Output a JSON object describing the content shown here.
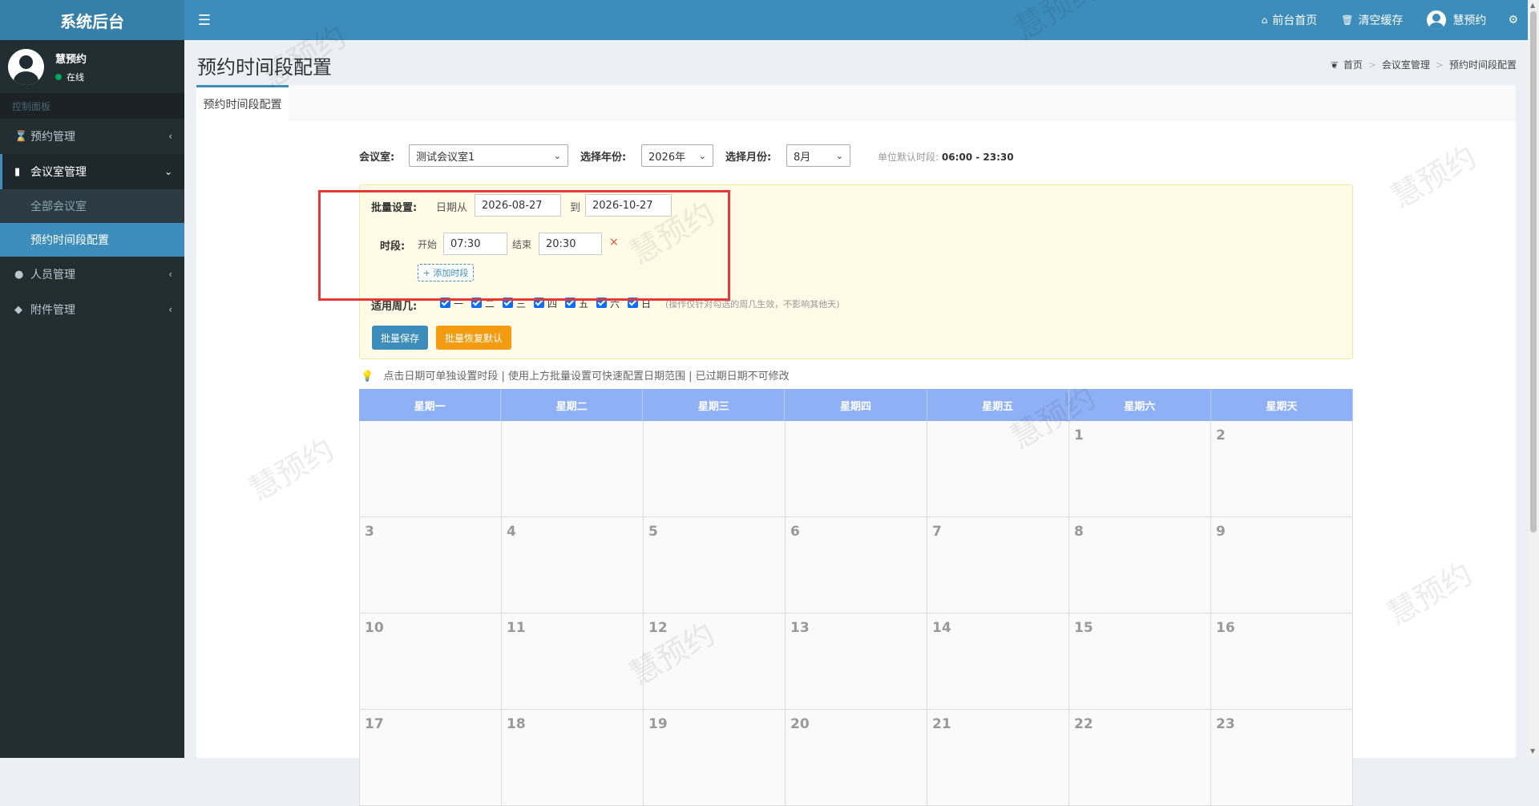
{
  "header": {
    "logo": "系统后台",
    "menu_toggle_icon": "menu-icon",
    "links": [
      {
        "icon": "home-icon",
        "label": "前台首页"
      },
      {
        "icon": "trash-icon",
        "label": "清空缓存"
      }
    ],
    "user_name": "慧预约",
    "settings_icon": "cogs-icon"
  },
  "sidebar": {
    "user_name": "慧预约",
    "user_status": "在线",
    "header": "控制面板",
    "items": [
      {
        "icon": "hourglass-icon",
        "label": "预约管理"
      },
      {
        "icon": "bookmark-icon",
        "label": "会议室管理"
      },
      {
        "icon": "user-icon",
        "label": "人员管理"
      },
      {
        "icon": "tags-icon",
        "label": "附件管理"
      }
    ],
    "subitems": [
      {
        "label": "全部会议室"
      },
      {
        "label": "预约时间段配置"
      }
    ]
  },
  "page": {
    "title": "预约时间段配置",
    "breadcrumb": [
      "首页",
      "会议室管理",
      "预约时间段配置"
    ],
    "tab": "预约时间段配置"
  },
  "filters": {
    "room_label": "会议室:",
    "room_value": "测试会议室1",
    "year_label": "选择年份:",
    "year_value": "2026年",
    "month_label": "选择月份:",
    "month_value": "8月",
    "default_label": "单位默认时段:",
    "default_value": "06:00 - 23:30"
  },
  "batch": {
    "label": "批量设置:",
    "date_from_label": "日期从",
    "date_from": "2026-08-27",
    "date_to_label": "到",
    "date_to": "2026-10-27",
    "slot_label": "时段:",
    "start_label": "开始",
    "start": "07:30",
    "end_label": "结束",
    "end": "20:30",
    "remove_symbol": "×",
    "add_slot": "+ 添加时段",
    "weekday_label": "适用周几:",
    "weekdays": [
      "一",
      "二",
      "三",
      "四",
      "五",
      "六",
      "日"
    ],
    "weekday_note": "(操作仅针对勾选的周几生效，不影响其他天)",
    "save_button": "批量保存",
    "restore_button": "批量恢复默认"
  },
  "tip": "点击日期可单独设置时段 | 使用上方批量设置可快速配置日期范围 | 已过期日期不可修改",
  "calendar": {
    "headers": [
      "星期一",
      "星期二",
      "星期三",
      "星期四",
      "星期五",
      "星期六",
      "星期天"
    ],
    "rows": [
      [
        "",
        "",
        "",
        "",
        "",
        "1",
        "2"
      ],
      [
        "3",
        "4",
        "5",
        "6",
        "7",
        "8",
        "9"
      ],
      [
        "10",
        "11",
        "12",
        "13",
        "14",
        "15",
        "16"
      ],
      [
        "17",
        "18",
        "19",
        "20",
        "21",
        "22",
        "23"
      ]
    ]
  },
  "watermark": "慧预约"
}
